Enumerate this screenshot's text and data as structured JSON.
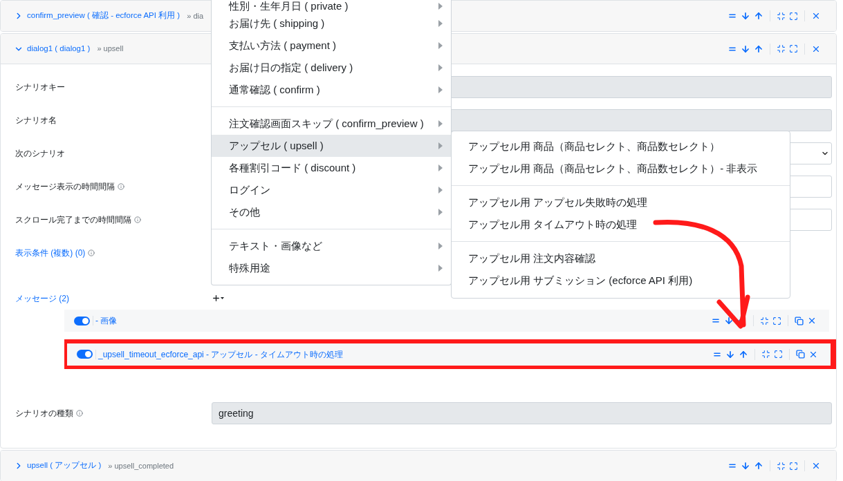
{
  "panels": [
    {
      "title": "confirm_preview ( 確認 - ecforce API 利用 )",
      "next": "» dia",
      "expanded": false
    },
    {
      "title": "dialog1 ( dialog1 )",
      "next": "» upsell",
      "expanded": true
    },
    {
      "title": "upsell ( アップセル )",
      "next": "» upsell_completed",
      "expanded": false
    }
  ],
  "form": {
    "rows": [
      {
        "label": "シナリオキー",
        "info": false,
        "kind": "readonly"
      },
      {
        "label": "シナリオ名",
        "info": false,
        "kind": "readonly"
      },
      {
        "label": "次のシナリオ",
        "info": false,
        "kind": "select"
      },
      {
        "label": "メッセージ表示の時間間隔",
        "info": true,
        "kind": "input"
      },
      {
        "label": "スクロール完了までの時間間隔",
        "info": true,
        "kind": "input"
      },
      {
        "label": "表示条件 (複数) (0)",
        "info": true,
        "kind": "link"
      }
    ],
    "messages_label": "メッセージ (2)",
    "messages": [
      {
        "label": "- 画像",
        "enabled": true,
        "highlighted": false
      },
      {
        "label": "_upsell_timeout_ecforce_api - アップセル - タイムアウト時の処理",
        "enabled": true,
        "highlighted": true
      }
    ],
    "type_label": "シナリオの種類",
    "type_value": "greeting"
  },
  "menu": {
    "items": [
      {
        "kind": "item",
        "label": "性別・生年月日 ( private )",
        "selected": false
      },
      {
        "kind": "item",
        "label": "お届け先 ( shipping )",
        "selected": false
      },
      {
        "kind": "item",
        "label": "支払い方法 ( payment )",
        "selected": false
      },
      {
        "kind": "item",
        "label": "お届け日の指定 ( delivery )",
        "selected": false
      },
      {
        "kind": "item",
        "label": "通常確認 ( confirm )",
        "selected": false
      },
      {
        "kind": "separator"
      },
      {
        "kind": "item",
        "label": "注文確認画面スキップ ( confirm_preview )",
        "selected": false
      },
      {
        "kind": "item",
        "label": "アップセル ( upsell )",
        "selected": true
      },
      {
        "kind": "item",
        "label": "各種割引コード ( discount )",
        "selected": false
      },
      {
        "kind": "item",
        "label": "ログイン",
        "selected": false
      },
      {
        "kind": "item",
        "label": "その他",
        "selected": false
      },
      {
        "kind": "separator"
      },
      {
        "kind": "item",
        "label": "テキスト・画像など",
        "selected": false
      },
      {
        "kind": "item",
        "label": "特殊用途",
        "selected": false
      }
    ]
  },
  "submenu": {
    "items": [
      {
        "kind": "item",
        "label": "アップセル用 商品（商品セレクト、商品数セレクト）"
      },
      {
        "kind": "item",
        "label": "アップセル用 商品（商品セレクト、商品数セレクト）- 非表示"
      },
      {
        "kind": "separator"
      },
      {
        "kind": "item",
        "label": "アップセル用 アップセル失敗時の処理"
      },
      {
        "kind": "item",
        "label": "アップセル用 タイムアウト時の処理"
      },
      {
        "kind": "separator"
      },
      {
        "kind": "item",
        "label": "アップセル用 注文内容確認"
      },
      {
        "kind": "item",
        "label": "アップセル用 サブミッション (ecforce API 利用)"
      }
    ]
  }
}
